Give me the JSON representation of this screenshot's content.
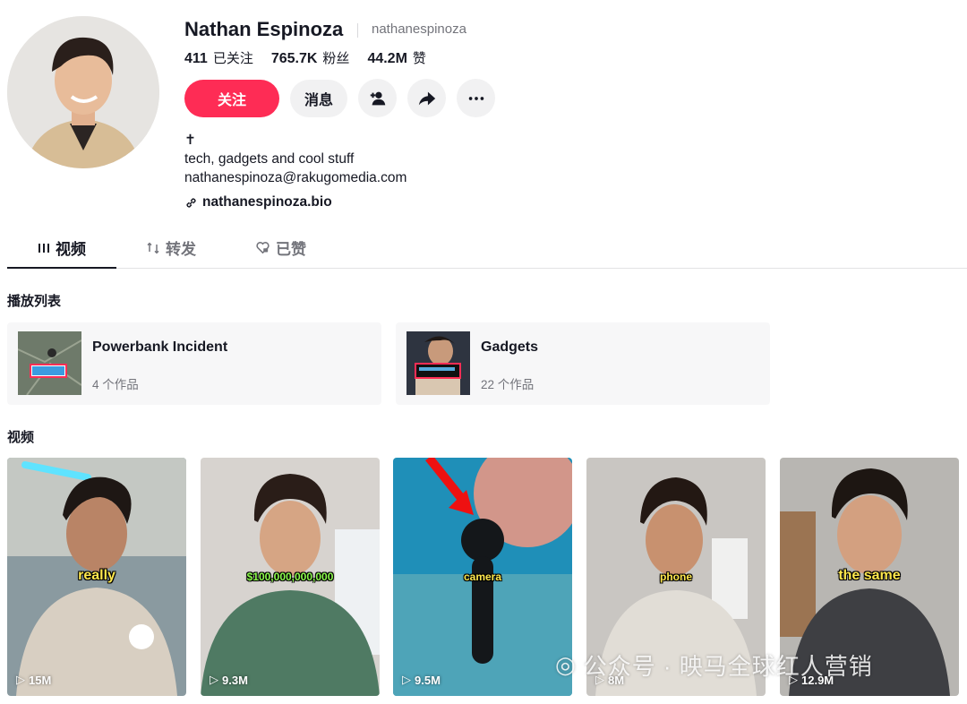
{
  "profile": {
    "name": "Nathan Espinoza",
    "handle": "nathanespinoza",
    "stats": [
      {
        "value": "411",
        "label": "已关注"
      },
      {
        "value": "765.7K",
        "label": "粉丝"
      },
      {
        "value": "44.2M",
        "label": "赞"
      }
    ],
    "follow_label": "关注",
    "message_label": "消息",
    "bio_lines": [
      "✝",
      "tech, gadgets and cool stuff",
      "nathanespinoza@rakugomedia.com"
    ],
    "link": "nathanespinoza.bio"
  },
  "tabs": [
    {
      "label": "视频",
      "icon": "grid-icon",
      "active": true
    },
    {
      "label": "转发",
      "icon": "repost-icon",
      "active": false
    },
    {
      "label": "已赞",
      "icon": "liked-heart-icon",
      "active": false
    }
  ],
  "playlists_title": "播放列表",
  "playlists": [
    {
      "title": "Powerbank Incident",
      "count": "4 个作品"
    },
    {
      "title": "Gadgets",
      "count": "22 个作品"
    }
  ],
  "videos_title": "视频",
  "videos": [
    {
      "caption": "really",
      "views": "15M"
    },
    {
      "caption": "$100,000,000,000",
      "views": "9.3M"
    },
    {
      "caption": "camera",
      "views": "9.5M"
    },
    {
      "caption": "phone",
      "views": "8M"
    },
    {
      "caption": "the same",
      "views": "12.9M"
    }
  ],
  "watermark": "公众号 · 映马全球红人营销",
  "colors": {
    "accent": "#fe2c55",
    "muted": "#73747b",
    "text": "#161823"
  }
}
